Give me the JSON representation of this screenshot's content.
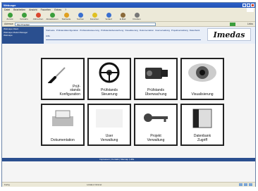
{
  "window": {
    "title": "Webcape",
    "menu": [
      "Datei",
      "Bearbeiten",
      "Ansicht",
      "Favoriten",
      "Extras",
      "?"
    ]
  },
  "toolbar": [
    {
      "label": "Zurück",
      "icon": "back-arrow-icon",
      "color": "#3c9e3c"
    },
    {
      "label": "Vorwärts",
      "icon": "forward-arrow-icon",
      "color": "#3c9e3c"
    },
    {
      "label": "Abbrechen",
      "icon": "stop-icon",
      "color": "#d9482f"
    },
    {
      "label": "Aktualisieren",
      "icon": "refresh-icon",
      "color": "#3c9e3c"
    },
    {
      "label": "Startseite",
      "icon": "home-icon",
      "color": "#e0a020"
    },
    {
      "label": "Suchen",
      "icon": "search-icon",
      "color": "#3a6fcf"
    },
    {
      "label": "Favoriten",
      "icon": "favorites-icon",
      "color": "#e0c020"
    },
    {
      "label": "Verlauf",
      "icon": "history-icon",
      "color": "#3a6fcf"
    },
    {
      "label": "E-Mail",
      "icon": "mail-icon",
      "color": "#8a6a3a"
    },
    {
      "label": "Drucken",
      "icon": "print-icon",
      "color": "#777777"
    }
  ],
  "address": {
    "label": "Adresse",
    "value": "http://imedas/",
    "links_label": "Links"
  },
  "app": {
    "left_panel": [
      "Webcape Client",
      "Webcape Modul Manager",
      "Webcape"
    ],
    "nav_links": [
      "Startseite",
      "Prüfstandskonfiguration",
      "Prüfstandssteuerung",
      "Prüfstandsüberwachung",
      "Visualisierung",
      "Dokumentation",
      "Userverwaltung",
      "Projektverwaltung",
      "Datenbank",
      "Hilfe"
    ],
    "logo_text": "Imedas"
  },
  "tiles": [
    {
      "caption": "Prüf-\nstands\nKonfiguration",
      "icon": "screwdriver-icon"
    },
    {
      "caption": "Prüfstands\nSteuerung",
      "icon": "steering-wheel-icon"
    },
    {
      "caption": "Prüfstands\nÜberwachung",
      "icon": "video-camera-icon"
    },
    {
      "caption": "Visualisierung",
      "icon": "eye-icon"
    },
    {
      "caption": "Dokumentation",
      "icon": "printer-icon"
    },
    {
      "caption": "User\nVerwaltung",
      "icon": "user-icon"
    },
    {
      "caption": "Projekt\nVerwaltung",
      "icon": "key-icon"
    },
    {
      "caption": "Datenbank\nZugriff",
      "icon": "database-cabinet-icon"
    }
  ],
  "footer": {
    "text": "Impressum | Kontakt | Sitemap | Hilfe"
  },
  "status": {
    "left": "Fertig",
    "right": "Lokales Intranet"
  }
}
